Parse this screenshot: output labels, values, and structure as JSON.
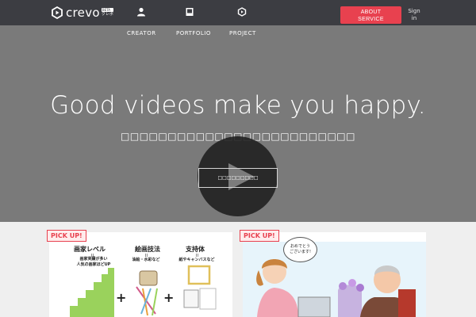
{
  "brand": {
    "name": "crevo",
    "badge": "BETA",
    "kana": "クレボ",
    "accent": "#e8414f",
    "topbar_color": "#3c3d42"
  },
  "header": {
    "nav": [
      {
        "icon": "person-icon",
        "label": "CREATOR"
      },
      {
        "icon": "portfolio-icon",
        "label": "PORTFOLIO"
      },
      {
        "icon": "crevo-logo-icon",
        "label": "PROJECT"
      }
    ],
    "about_button": {
      "line1": "ABOUT",
      "line2": "SERVICE"
    },
    "signin": {
      "line1": "Sign",
      "line2": "in"
    }
  },
  "hero": {
    "title": "Good videos make you happy.",
    "subtitle": "□□□□□□□□□□□□□□□□□□□□□□□□□",
    "button_label": "□□□□□□□□□",
    "play_icon": "play-icon"
  },
  "picks": [
    {
      "badge": "PICK UP!",
      "columns": [
        {
          "head": "画家レベル",
          "eq": "II",
          "note": [
            "画家実績が多い",
            "人気の画家ほどUP"
          ]
        },
        {
          "head": "絵画技法",
          "eq": "II",
          "note": [
            "油絵・水彩など"
          ]
        },
        {
          "head": "支持体",
          "eq": "II",
          "note": [
            "紙やキャンバスなど"
          ]
        }
      ],
      "operators": [
        "+",
        "+"
      ]
    },
    {
      "badge": "PICK UP!",
      "speech": [
        "おめでとう",
        "ございます!"
      ]
    }
  ]
}
